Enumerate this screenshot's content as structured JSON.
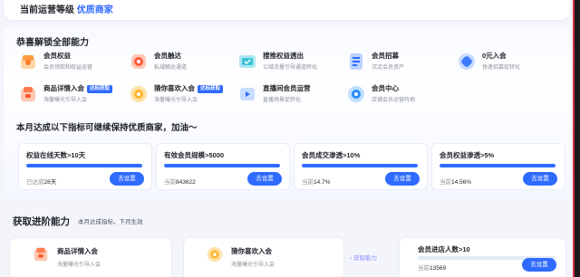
{
  "header": {
    "prefix": "当前运营等级",
    "level": "优质商家"
  },
  "unlocked": {
    "title": "恭喜解锁全部能力",
    "items": [
      {
        "name": "会员权益",
        "desc": "会员领取和权益运营",
        "icon": "gift-icon",
        "badge": ""
      },
      {
        "name": "会员触达",
        "desc": "私域触达通道",
        "icon": "bell-icon",
        "badge": ""
      },
      {
        "name": "搜推权益透出",
        "desc": "公域流量引导通道转化",
        "icon": "search-rank-icon",
        "badge": ""
      },
      {
        "name": "会员招募",
        "desc": "沉淀会员资产",
        "icon": "recruit-icon",
        "badge": ""
      },
      {
        "name": "0元入会",
        "desc": "快速招募促转化",
        "icon": "zero-join-icon",
        "badge": ""
      },
      {
        "name": "商品详情入会",
        "desc": "海量曝光引导入会",
        "icon": "product-detail-icon",
        "badge": "达标获取"
      },
      {
        "name": "猜你喜欢入会",
        "desc": "海量曝光引导入会",
        "icon": "guess-like-icon",
        "badge": "达标获取"
      },
      {
        "name": "直播间会员运营",
        "desc": "直播场景促转化",
        "icon": "live-icon",
        "badge": ""
      },
      {
        "name": "会员中心",
        "desc": "店铺会员运营阵地",
        "icon": "member-center-icon",
        "badge": ""
      }
    ]
  },
  "keep": {
    "title": "本月达成以下指标可继续保持优质商家，加油～",
    "metrics": [
      {
        "name": "权益在线天数>10天",
        "current_label": "已达成",
        "current_value": "28天",
        "progress": 1.0,
        "button": "去设置"
      },
      {
        "name": "有效会员规模>5000",
        "current_label": "当前",
        "current_value": "843622",
        "progress": 1.0,
        "button": "去设置"
      },
      {
        "name": "会员成交渗透>10%",
        "current_label": "当前",
        "current_value": "14.7%",
        "progress": 1.0,
        "button": "去设置"
      },
      {
        "name": "会员权益渗透>5%",
        "current_label": "当前",
        "current_value": "14.56%",
        "progress": 1.0,
        "button": "去设置"
      }
    ]
  },
  "advanced": {
    "title": "获取进阶能力",
    "subtitle": "本月达成指标，下月生效",
    "abilities": [
      {
        "name": "商品详情入会",
        "desc": "海量曝光引导入会",
        "icon": "product-detail-icon"
      },
      {
        "name": "猜你喜欢入会",
        "desc": "海量曝光引导入会",
        "icon": "guess-like-icon"
      }
    ],
    "arrow_label": "获取能力",
    "target": {
      "name": "会员进店人数>10",
      "current_label": "当前",
      "current_value": "13569",
      "progress": 1.0,
      "button": "去设置"
    }
  },
  "colors": {
    "accent": "#2f6bff",
    "badge": "#2f6bff"
  }
}
